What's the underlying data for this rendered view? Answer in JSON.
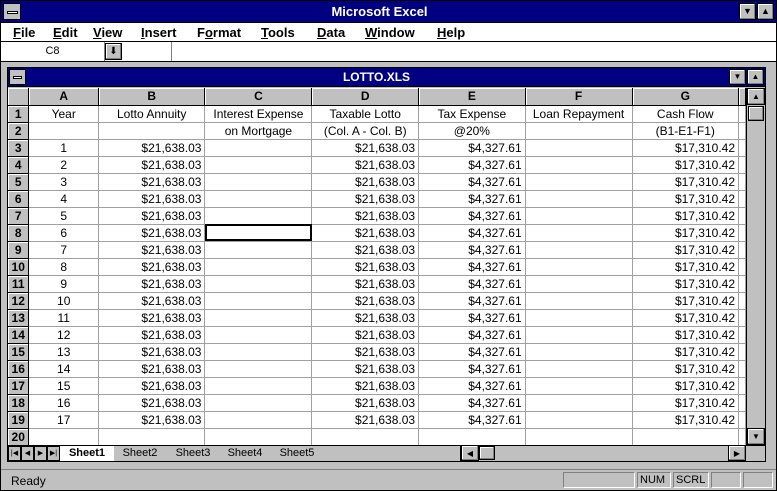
{
  "app": {
    "title": "Microsoft Excel"
  },
  "menu": [
    {
      "label": "File",
      "key": "F"
    },
    {
      "label": "Edit",
      "key": "E"
    },
    {
      "label": "View",
      "key": "V"
    },
    {
      "label": "Insert",
      "key": "I"
    },
    {
      "label": "Format",
      "key": "o"
    },
    {
      "label": "Tools",
      "key": "T"
    },
    {
      "label": "Data",
      "key": "D"
    },
    {
      "label": "Window",
      "key": "W"
    },
    {
      "label": "Help",
      "key": "H"
    }
  ],
  "namebox": {
    "value": "C8"
  },
  "workbook": {
    "title": "LOTTO.XLS"
  },
  "columns": [
    "A",
    "B",
    "C",
    "D",
    "E",
    "F",
    "G"
  ],
  "header_row1": [
    "Year",
    "Lotto Annuity",
    "Interest Expense",
    "Taxable Lotto",
    "Tax Expense",
    "Loan Repayment",
    "Cash Flow"
  ],
  "header_row2": [
    "",
    "",
    "on Mortgage",
    "(Col. A - Col. B)",
    "@20%",
    "",
    "(B1-E1-F1)"
  ],
  "rows": [
    {
      "year": "1",
      "annuity": "$21,638.03",
      "taxable": "$21,638.03",
      "tax": "$4,327.61",
      "cash": "$17,310.42"
    },
    {
      "year": "2",
      "annuity": "$21,638.03",
      "taxable": "$21,638.03",
      "tax": "$4,327.61",
      "cash": "$17,310.42"
    },
    {
      "year": "3",
      "annuity": "$21,638.03",
      "taxable": "$21,638.03",
      "tax": "$4,327.61",
      "cash": "$17,310.42"
    },
    {
      "year": "4",
      "annuity": "$21,638.03",
      "taxable": "$21,638.03",
      "tax": "$4,327.61",
      "cash": "$17,310.42"
    },
    {
      "year": "5",
      "annuity": "$21,638.03",
      "taxable": "$21,638.03",
      "tax": "$4,327.61",
      "cash": "$17,310.42"
    },
    {
      "year": "6",
      "annuity": "$21,638.03",
      "taxable": "$21,638.03",
      "tax": "$4,327.61",
      "cash": "$17,310.42"
    },
    {
      "year": "7",
      "annuity": "$21,638.03",
      "taxable": "$21,638.03",
      "tax": "$4,327.61",
      "cash": "$17,310.42"
    },
    {
      "year": "8",
      "annuity": "$21,638.03",
      "taxable": "$21,638.03",
      "tax": "$4,327.61",
      "cash": "$17,310.42"
    },
    {
      "year": "9",
      "annuity": "$21,638.03",
      "taxable": "$21,638.03",
      "tax": "$4,327.61",
      "cash": "$17,310.42"
    },
    {
      "year": "10",
      "annuity": "$21,638.03",
      "taxable": "$21,638.03",
      "tax": "$4,327.61",
      "cash": "$17,310.42"
    },
    {
      "year": "11",
      "annuity": "$21,638.03",
      "taxable": "$21,638.03",
      "tax": "$4,327.61",
      "cash": "$17,310.42"
    },
    {
      "year": "12",
      "annuity": "$21,638.03",
      "taxable": "$21,638.03",
      "tax": "$4,327.61",
      "cash": "$17,310.42"
    },
    {
      "year": "13",
      "annuity": "$21,638.03",
      "taxable": "$21,638.03",
      "tax": "$4,327.61",
      "cash": "$17,310.42"
    },
    {
      "year": "14",
      "annuity": "$21,638.03",
      "taxable": "$21,638.03",
      "tax": "$4,327.61",
      "cash": "$17,310.42"
    },
    {
      "year": "15",
      "annuity": "$21,638.03",
      "taxable": "$21,638.03",
      "tax": "$4,327.61",
      "cash": "$17,310.42"
    },
    {
      "year": "16",
      "annuity": "$21,638.03",
      "taxable": "$21,638.03",
      "tax": "$4,327.61",
      "cash": "$17,310.42"
    },
    {
      "year": "17",
      "annuity": "$21,638.03",
      "taxable": "$21,638.03",
      "tax": "$4,327.61",
      "cash": "$17,310.42"
    }
  ],
  "sheets": [
    "Sheet1",
    "Sheet2",
    "Sheet3",
    "Sheet4",
    "Sheet5"
  ],
  "active_sheet": "Sheet1",
  "status": {
    "text": "Ready",
    "num": "NUM",
    "scrl": "SCRL"
  },
  "colors": {
    "titlebar": "#000080",
    "chrome": "#c0c0c0"
  },
  "icons": {
    "system_menu": "system-menu-icon",
    "minimize": "minimize-arrow-icon",
    "maximize": "maximize-arrow-icon",
    "dropdown": "dropdown-arrow-icon",
    "scroll_up": "scroll-up-arrow-icon",
    "scroll_down": "scroll-down-arrow-icon",
    "scroll_left": "scroll-left-arrow-icon",
    "scroll_right": "scroll-right-arrow-icon"
  }
}
